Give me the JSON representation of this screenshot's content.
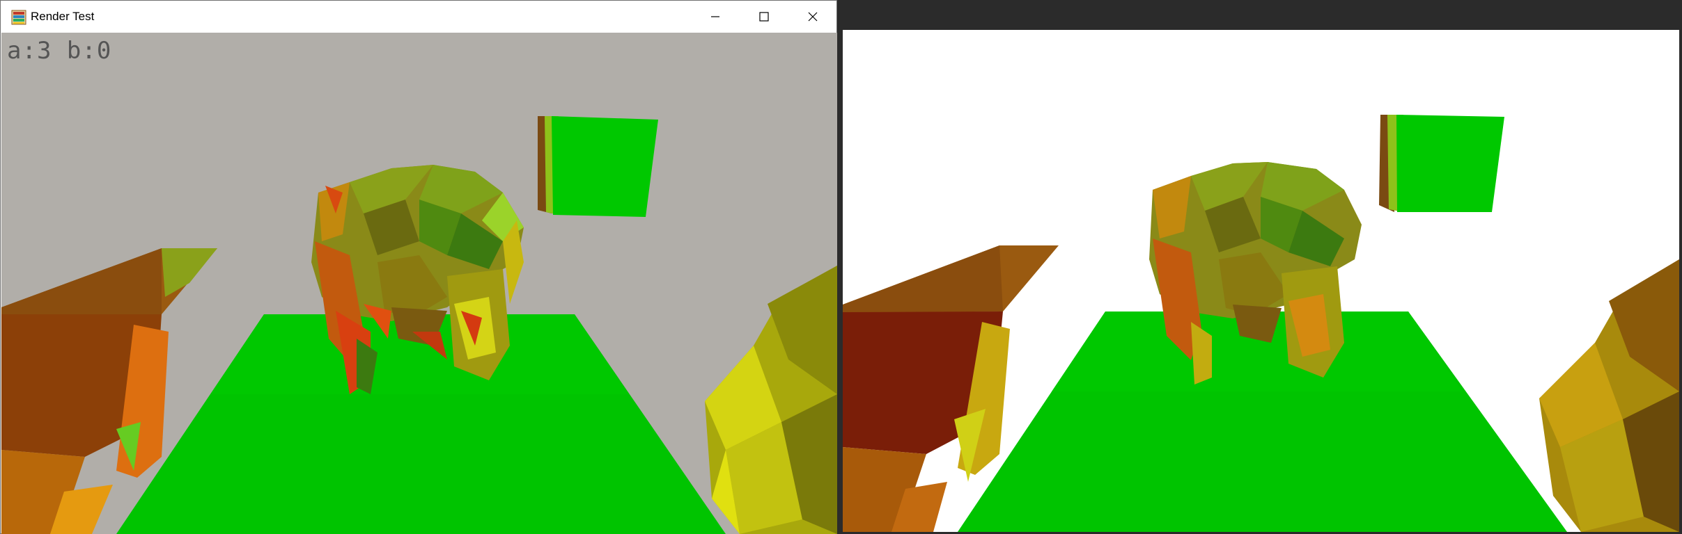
{
  "window": {
    "title": "Render Test",
    "app_icon": "app-icon",
    "controls": {
      "minimize_icon": "minimize-icon",
      "maximize_icon": "maximize-icon",
      "close_icon": "close-icon"
    }
  },
  "hud": {
    "text": "a:3 b:0"
  },
  "colors": {
    "sky_left": "#b1aea9",
    "sky_right": "#ffffff",
    "floor": "#00c800",
    "desktop": "#2b2b2b"
  }
}
